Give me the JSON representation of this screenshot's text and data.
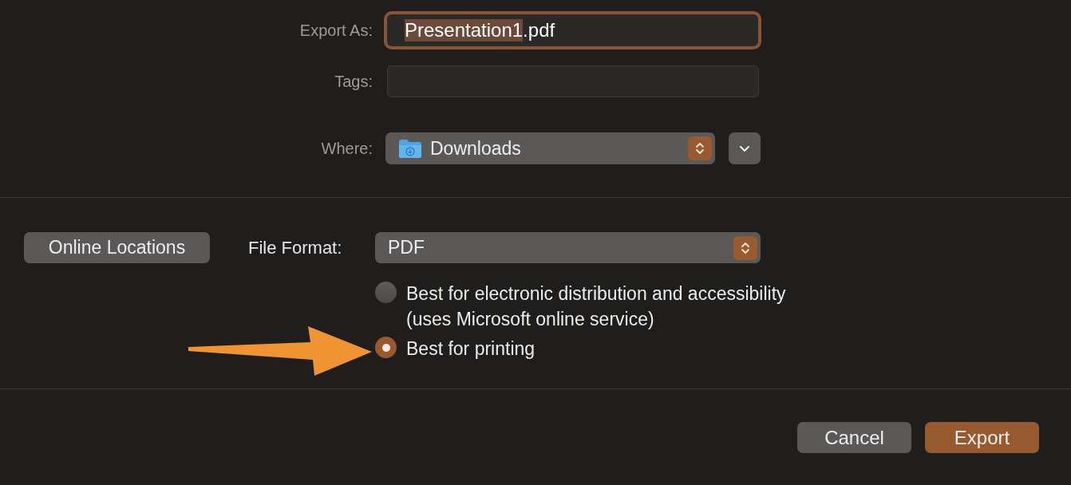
{
  "export_as": {
    "label": "Export As:",
    "selected_text": "Presentation1",
    "rest_text": ".pdf"
  },
  "tags": {
    "label": "Tags:"
  },
  "where": {
    "label": "Where:",
    "value": "Downloads"
  },
  "online_locations": {
    "label": "Online Locations"
  },
  "file_format": {
    "label": "File Format:",
    "value": "PDF"
  },
  "options": [
    {
      "lines": [
        "Best for electronic distribution and accessibility",
        "(uses Microsoft online service)"
      ],
      "selected": false
    },
    {
      "lines": [
        "Best for printing"
      ],
      "selected": true
    }
  ],
  "buttons": [
    {
      "label": "Cancel",
      "kind": "secondary"
    },
    {
      "label": "Export",
      "kind": "primary"
    }
  ]
}
